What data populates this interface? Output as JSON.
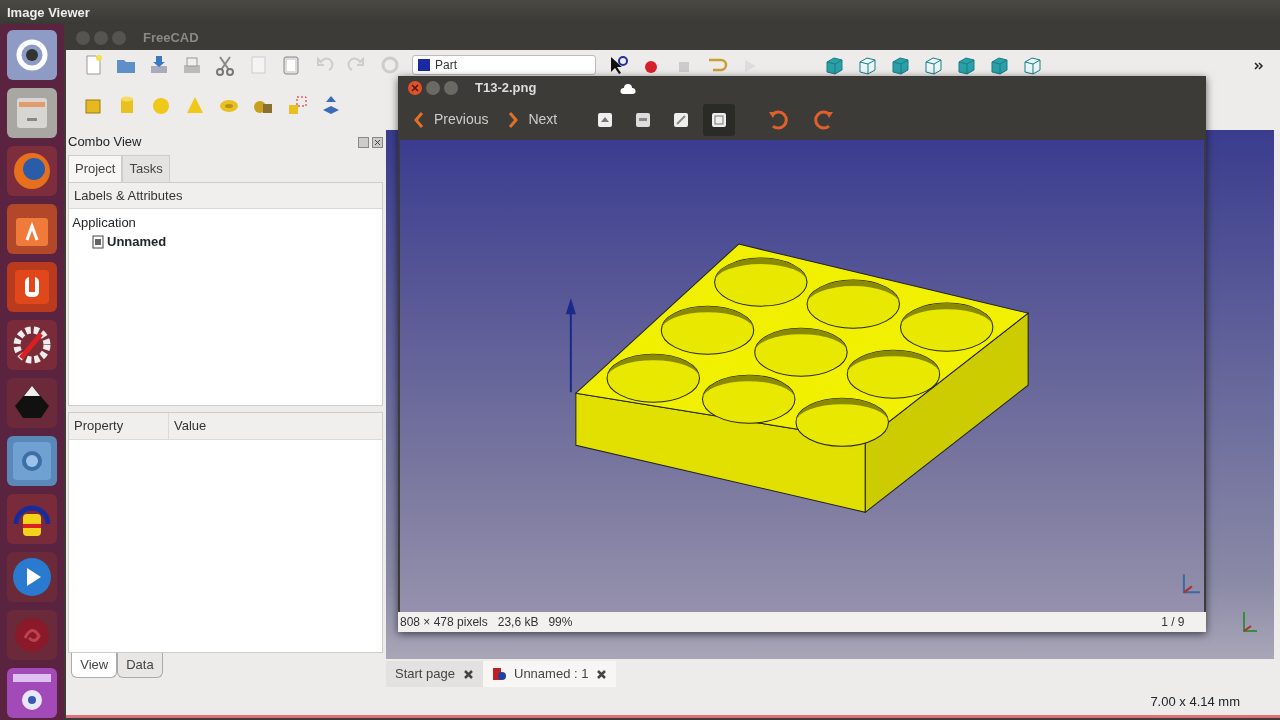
{
  "top_bar": {
    "title": "Image Viewer"
  },
  "freecad": {
    "title": "FreeCAD",
    "workbench": {
      "value": "Part"
    },
    "combo_view": {
      "title": "Combo View",
      "tabs": [
        {
          "label": "Project",
          "selected": true
        },
        {
          "label": "Tasks",
          "selected": false
        }
      ],
      "tree": {
        "header": "Labels & Attributes",
        "items": [
          {
            "label": "Application",
            "children": [
              {
                "label": "Unnamed"
              }
            ]
          }
        ]
      },
      "property_table": {
        "columns": [
          "Property",
          "Value"
        ]
      },
      "bottom_tabs": [
        {
          "label": "View",
          "selected": true
        },
        {
          "label": "Data",
          "selected": false
        }
      ]
    },
    "document_tabs": [
      {
        "label": "Start page",
        "selected": false
      },
      {
        "label": "Unnamed : 1",
        "selected": true
      }
    ],
    "status_bar": {
      "dimensions": "7.00 x 4.14 mm"
    }
  },
  "image_viewer": {
    "title": "T13-2.png",
    "nav": [
      {
        "label": "Previous",
        "kind": "previous"
      },
      {
        "label": "Next",
        "kind": "next"
      }
    ],
    "view_buttons": [
      {
        "selected": false
      },
      {
        "selected": false
      },
      {
        "selected": false
      },
      {
        "selected": true
      }
    ],
    "status": {
      "size": "808 × 478 pixels",
      "file_size": "23,6 kB",
      "zoom": "99%",
      "position": "1 / 9"
    }
  }
}
